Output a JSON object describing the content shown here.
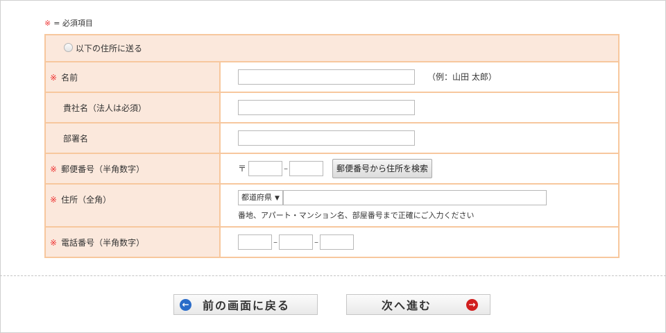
{
  "required_note": {
    "mark": "※",
    "text": "= 必須項目"
  },
  "colors": {
    "label_bg": "#fbe8dc",
    "border": "#f7c79d",
    "required_mark": "#e33333",
    "back_icon": "#2a6cc9",
    "next_icon": "#d11f1f"
  },
  "send_option": {
    "label": "以下の住所に送る",
    "selected": false
  },
  "fields": {
    "name": {
      "label": "名前",
      "required": "※",
      "value": "",
      "example": "（例：山田 太郎）"
    },
    "company": {
      "label": "貴社名（法人は必須）",
      "value": ""
    },
    "department": {
      "label": "部署名",
      "value": ""
    },
    "zip": {
      "label": "郵便番号（半角数字）",
      "required": "※",
      "mark": "〒",
      "part1": "",
      "part2": "",
      "separator": "–",
      "search_button": "郵便番号から住所を検索"
    },
    "address": {
      "label": "住所（全角）",
      "required": "※",
      "prefecture": "都道府県",
      "select_arrow": "▼",
      "value": "",
      "note": "番地、アパート・マンション名、部屋番号まで正確にご入力ください"
    },
    "phone": {
      "label": "電話番号（半角数字）",
      "required": "※",
      "part1": "",
      "part2": "",
      "part3": "",
      "separator": "–"
    }
  },
  "buttons": {
    "back": {
      "label": "前の画面に戻る",
      "icon": "arrow-left-circle-icon",
      "glyph": "←"
    },
    "next": {
      "label": "次へ進む",
      "icon": "arrow-right-circle-icon",
      "glyph": "→"
    }
  }
}
